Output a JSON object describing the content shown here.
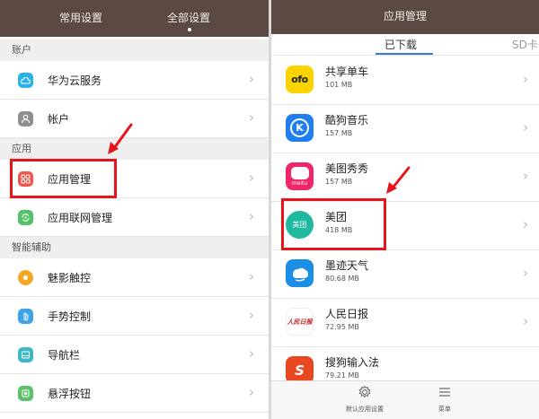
{
  "left": {
    "tabs": [
      "常用设置",
      "全部设置"
    ],
    "sections": {
      "account": "账户",
      "apps": "应用",
      "assist": "智能辅助"
    },
    "items": {
      "huawei_cloud": "华为云服务",
      "account": "帐户",
      "app_manage": "应用管理",
      "app_network": "应用联网管理",
      "shadow_touch": "魅影触控",
      "gesture": "手势控制",
      "navbar": "导航栏",
      "float_button": "悬浮按钮"
    }
  },
  "right": {
    "title": "应用管理",
    "tabs": {
      "downloaded": "已下载",
      "sd": "SD卡"
    },
    "apps": [
      {
        "name": "共享单车",
        "size": "101 MB",
        "icon_text": "ofo",
        "color": "#fbd300"
      },
      {
        "name": "酷狗音乐",
        "size": "157 MB",
        "icon_text": "K",
        "color": "#1f7ff0"
      },
      {
        "name": "美图秀秀",
        "size": "157 MB",
        "icon_text": "meitu",
        "color": "#f0266b"
      },
      {
        "name": "美团",
        "size": "418 MB",
        "icon_text": "美团",
        "color": "#1fb9a0"
      },
      {
        "name": "墨迹天气",
        "size": "80.68 MB",
        "icon_text": "",
        "color": "#1a8fe3"
      },
      {
        "name": "人民日报",
        "size": "72.95 MB",
        "icon_text": "人民日报",
        "color": "#c81d1d"
      },
      {
        "name": "搜狗输入法",
        "size": "79.21 MB",
        "icon_text": "S",
        "color": "#e8471f"
      }
    ],
    "bottom": {
      "default_settings": "默认应用设置",
      "menu": "菜单"
    }
  }
}
